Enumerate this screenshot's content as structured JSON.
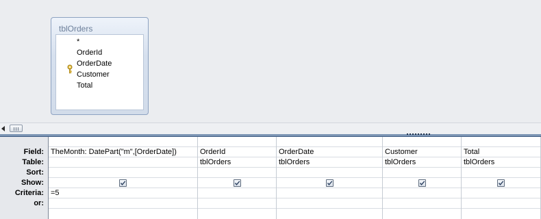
{
  "diagram": {
    "table": {
      "title": "tblOrders",
      "fields": [
        "*",
        "OrderId",
        "OrderDate",
        "Customer",
        "Total"
      ],
      "primary_key": "OrderId"
    }
  },
  "grid": {
    "row_labels": [
      "Field:",
      "Table:",
      "Sort:",
      "Show:",
      "Criteria:",
      "or:"
    ],
    "columns": [
      {
        "field": "TheMonth: DatePart(\"m\",[OrderDate])",
        "table": "",
        "sort": "",
        "show": true,
        "criteria": "=5",
        "or": ""
      },
      {
        "field": "OrderId",
        "table": "tblOrders",
        "sort": "",
        "show": true,
        "criteria": "",
        "or": ""
      },
      {
        "field": "OrderDate",
        "table": "tblOrders",
        "sort": "",
        "show": true,
        "criteria": "",
        "or": ""
      },
      {
        "field": "Customer",
        "table": "tblOrders",
        "sort": "",
        "show": true,
        "criteria": "",
        "or": ""
      },
      {
        "field": "Total",
        "table": "tblOrders",
        "sort": "",
        "show": true,
        "criteria": "",
        "or": ""
      }
    ]
  }
}
